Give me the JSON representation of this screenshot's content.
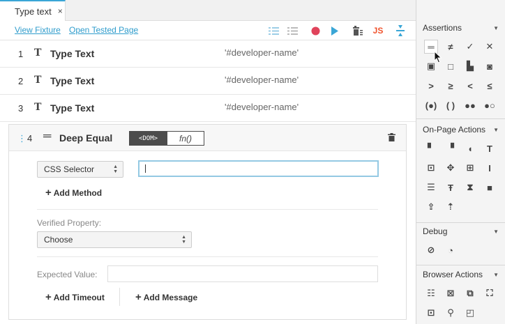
{
  "tab": {
    "label": "Type text",
    "close": "×"
  },
  "toolbar": {
    "view_fixture": "View Fixture",
    "open_tested_page": "Open Tested Page",
    "js_label": "JS"
  },
  "steps": [
    {
      "num": "1",
      "icon": "T",
      "name": "Type Text",
      "selector": "'#developer-name'"
    },
    {
      "num": "2",
      "icon": "T",
      "name": "Type Text",
      "selector": "'#developer-name'"
    },
    {
      "num": "3",
      "icon": "T",
      "name": "Type Text",
      "selector": "'#developer-name'"
    }
  ],
  "deep_equal": {
    "handle": "⋮",
    "num": "4",
    "icon": "═",
    "title": "Deep Equal",
    "dom_label": "<DOM>",
    "fn_label": "fn()",
    "selector_type": "CSS Selector",
    "selector_value": "",
    "add_method": "Add Method",
    "verified_property_label": "Verified Property:",
    "verified_property_value": "Choose",
    "expected_value_label": "Expected Value:",
    "expected_value": "",
    "add_timeout": "Add Timeout",
    "add_message": "Add Message"
  },
  "panel": {
    "assertions_title": "Assertions",
    "onpage_title": "On-Page Actions",
    "debug_title": "Debug",
    "browser_title": "Browser Actions"
  },
  "colors": {
    "accent": "#3aa6d6",
    "record": "#e0435b",
    "js": "#f0532d"
  }
}
